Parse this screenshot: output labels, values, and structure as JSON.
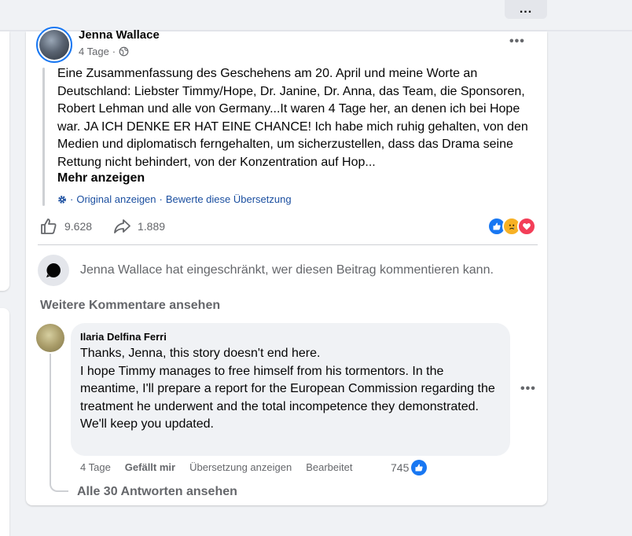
{
  "top_more": "...",
  "post": {
    "author": "Jenna Wallace",
    "time": "4 Tage",
    "separator": "·",
    "more": "•••",
    "text": "Eine Zusammenfassung des Geschehens am 20. April und meine Worte an Deutschland: Liebster Timmy/Hope, Dr. Janine, Dr. Anna, das Team, die Sponsoren, Robert Lehman und alle von Germany...It waren 4 Tage her, an denen ich bei Hope war. JA ICH DENKE ER HAT EINE CHANCE! Ich habe mich ruhig gehalten, von den Medien und diplomatisch ferngehalten, um sicherzustellen, dass das Drama seine Rettung nicht behindert, von der Konzentration auf Hop...",
    "see_more": "Mehr anzeigen",
    "translation": {
      "show_original": "Original anzeigen",
      "dot": "·",
      "rate": "Bewerte diese Übersetzung"
    },
    "likes": "9.628",
    "shares": "1.889",
    "reaction_colors": {
      "like": "#1877f2",
      "sad": "#f7b125",
      "love": "#f33e58"
    },
    "restricted_notice": "Jenna Wallace hat eingeschränkt, wer diesen Beitrag kommentieren kann."
  },
  "comments": {
    "more_label": "Weitere Kommentare ansehen",
    "items": [
      {
        "name": "Ilaria Delfina Ferri",
        "lines": [
          "Thanks, Jenna, this story doesn't end here.",
          "I hope Timmy manages to free himself from his tormentors. In the meantime, I'll prepare a report for the European Commission regarding the treatment he underwent and the total incompetence they demonstrated.",
          "We'll keep you updated."
        ],
        "time": "4 Tage",
        "like_action": "Gefällt mir",
        "translate_action": "Übersetzung anzeigen",
        "edited": "Bearbeitet",
        "reaction_count": "745",
        "more": "•••"
      }
    ],
    "all_replies": "Alle 30 Antworten ansehen"
  }
}
